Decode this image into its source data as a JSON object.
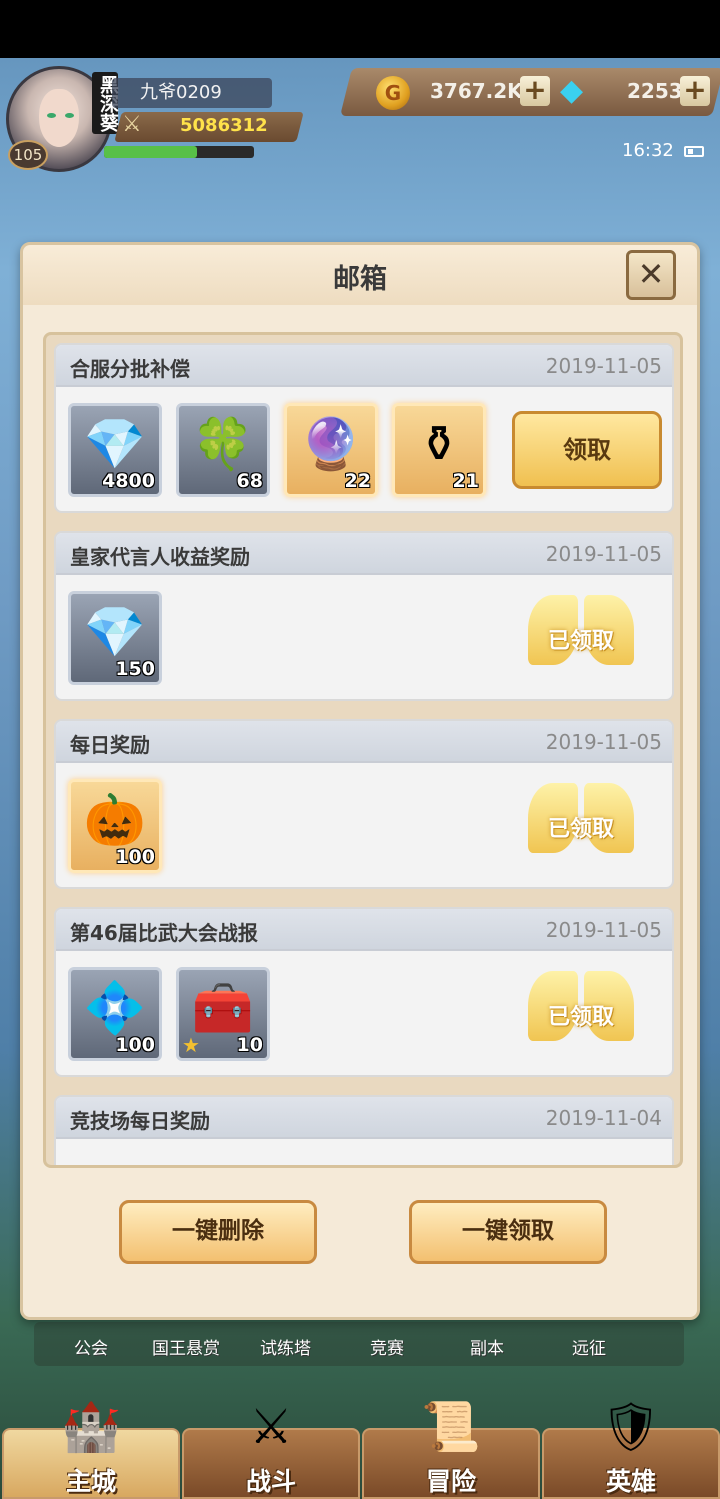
{
  "player": {
    "name": "九爷0209",
    "level": "105",
    "power": "5086312",
    "vip_tag": "黑深葵",
    "exp_fraction": 0.62
  },
  "currency": {
    "gold": "3767.2K",
    "gems": "2253",
    "plus": "+"
  },
  "status": {
    "time": "16:32"
  },
  "dialog": {
    "title": "邮箱",
    "close": "✕"
  },
  "mails": [
    {
      "title": "合服分批补偿",
      "date": "2019-11-05",
      "items": [
        {
          "icon": "diamond-icon",
          "glyph": "💎",
          "count": "4800"
        },
        {
          "icon": "clover-icon",
          "glyph": "🍀",
          "count": "68"
        },
        {
          "icon": "crystal-icon",
          "glyph": "🔮",
          "count": "22"
        },
        {
          "icon": "potion-icon",
          "glyph": "⚱",
          "count": "21"
        }
      ],
      "action": "领取"
    },
    {
      "title": "皇家代言人收益奖励",
      "date": "2019-11-05",
      "items": [
        {
          "icon": "diamond-icon",
          "glyph": "💎",
          "count": "150"
        }
      ],
      "claimed": "已领取"
    },
    {
      "title": "每日奖励",
      "date": "2019-11-05",
      "items": [
        {
          "icon": "pumpkin-icon",
          "glyph": "🎃",
          "count": "100"
        }
      ],
      "claimed": "已领取"
    },
    {
      "title": "第46届比武大会战报",
      "date": "2019-11-05",
      "items": [
        {
          "icon": "blue-crystal-icon",
          "glyph": "💠",
          "count": "100"
        },
        {
          "icon": "chest-icon",
          "glyph": "🧰",
          "count": "10"
        }
      ],
      "claimed": "已领取"
    },
    {
      "title": "竞技场每日奖励",
      "date": "2019-11-04"
    }
  ],
  "buttons": {
    "delete_all": "一键删除",
    "claim_all": "一键领取"
  },
  "sub_nav": [
    "公会",
    "国王悬赏",
    "试练塔",
    "竞赛",
    "副本",
    "远征"
  ],
  "main_nav": [
    {
      "label": "主城",
      "icon": "castle-icon",
      "glyph": "🏰"
    },
    {
      "label": "战斗",
      "icon": "swords-icon",
      "glyph": "⚔"
    },
    {
      "label": "冒险",
      "icon": "scroll-icon",
      "glyph": "📜"
    },
    {
      "label": "英雄",
      "icon": "hero-icon",
      "glyph": "🛡"
    }
  ]
}
